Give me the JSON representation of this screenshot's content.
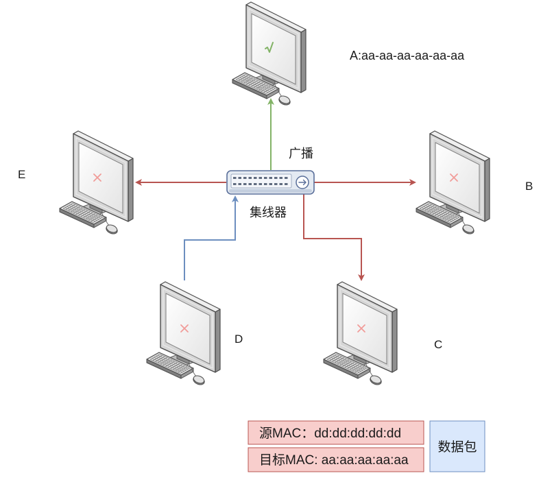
{
  "colors": {
    "broadcast_arrow": "#82b366",
    "forward_arrow": "#b85450",
    "send_arrow": "#6c8ebf",
    "check_mark": "#82b366",
    "cross_mark": "#f19c99",
    "hub_border": "#5a6f9a",
    "mac_box_fill": "#f8cecc",
    "mac_box_border": "#b85450",
    "data_box_fill": "#dae8fc",
    "data_box_border": "#6c8ebf"
  },
  "hub": {
    "label": "集线器"
  },
  "broadcast_label": "广播",
  "computers": [
    {
      "label": "A:aa-aa-aa-aa-aa-aa",
      "mark_icon": "check-icon"
    },
    {
      "label": "B",
      "mark_icon": "cross-icon"
    },
    {
      "label": "C",
      "mark_icon": "cross-icon"
    },
    {
      "label": "D",
      "mark_icon": "cross-icon"
    },
    {
      "label": "E",
      "mark_icon": "cross-icon"
    }
  ],
  "packet": {
    "source_mac": "源MAC：dd:dd:dd:dd:dd",
    "destination_mac": "目标MAC: aa:aa:aa:aa:aa",
    "payload": "数据包"
  }
}
